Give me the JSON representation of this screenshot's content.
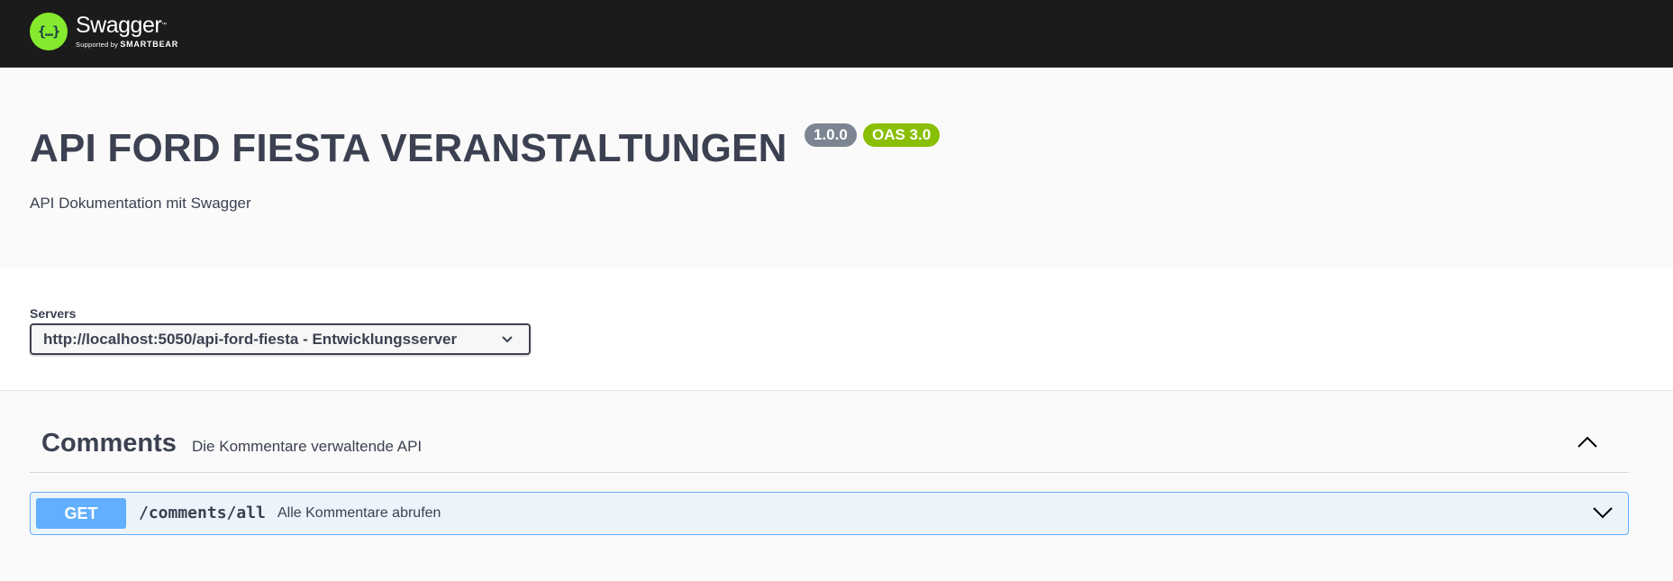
{
  "topbar": {
    "logo_glyph": "{…}",
    "logo_name": "Swagger",
    "logo_tm": "™",
    "logo_supported_prefix": "Supported by",
    "logo_supported_brand": "SMARTBEAR",
    "logo_color": "#85ea2d",
    "background": "#1b1b1b"
  },
  "info": {
    "title": "API FORD FIESTA VERANSTALTUNGEN",
    "version": "1.0.0",
    "oas": "OAS 3.0",
    "description": "API Dokumentation mit Swagger"
  },
  "servers": {
    "label": "Servers",
    "selected": "http://localhost:5050/api-ford-fiesta - Entwicklungsserver"
  },
  "tags": [
    {
      "name": "Comments",
      "description": "Die Kommentare verwaltende API",
      "expanded": true,
      "operations": [
        {
          "method": "GET",
          "path": "/comments/all",
          "summary": "Alle Kommentare abrufen",
          "method_color": "#61affe"
        }
      ]
    }
  ]
}
